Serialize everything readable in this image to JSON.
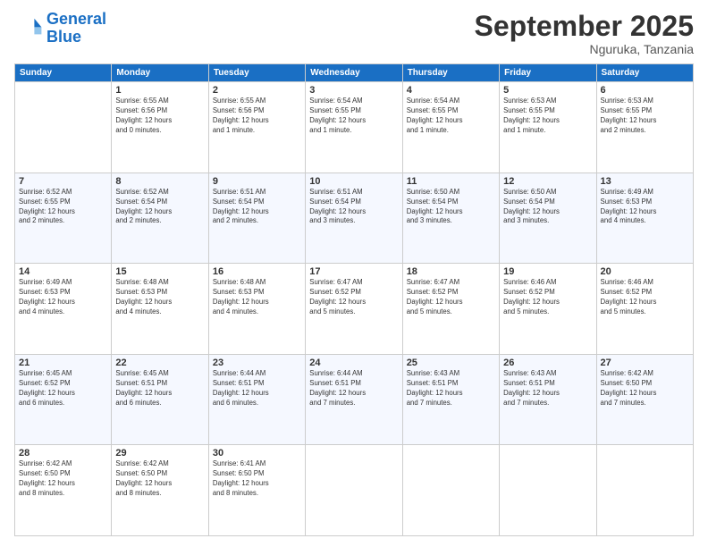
{
  "logo": {
    "line1": "General",
    "line2": "Blue"
  },
  "title": "September 2025",
  "location": "Nguruka, Tanzania",
  "days_header": [
    "Sunday",
    "Monday",
    "Tuesday",
    "Wednesday",
    "Thursday",
    "Friday",
    "Saturday"
  ],
  "weeks": [
    [
      {
        "day": "",
        "info": ""
      },
      {
        "day": "1",
        "info": "Sunrise: 6:55 AM\nSunset: 6:56 PM\nDaylight: 12 hours\nand 0 minutes."
      },
      {
        "day": "2",
        "info": "Sunrise: 6:55 AM\nSunset: 6:56 PM\nDaylight: 12 hours\nand 1 minute."
      },
      {
        "day": "3",
        "info": "Sunrise: 6:54 AM\nSunset: 6:55 PM\nDaylight: 12 hours\nand 1 minute."
      },
      {
        "day": "4",
        "info": "Sunrise: 6:54 AM\nSunset: 6:55 PM\nDaylight: 12 hours\nand 1 minute."
      },
      {
        "day": "5",
        "info": "Sunrise: 6:53 AM\nSunset: 6:55 PM\nDaylight: 12 hours\nand 1 minute."
      },
      {
        "day": "6",
        "info": "Sunrise: 6:53 AM\nSunset: 6:55 PM\nDaylight: 12 hours\nand 2 minutes."
      }
    ],
    [
      {
        "day": "7",
        "info": "Sunrise: 6:52 AM\nSunset: 6:55 PM\nDaylight: 12 hours\nand 2 minutes."
      },
      {
        "day": "8",
        "info": "Sunrise: 6:52 AM\nSunset: 6:54 PM\nDaylight: 12 hours\nand 2 minutes."
      },
      {
        "day": "9",
        "info": "Sunrise: 6:51 AM\nSunset: 6:54 PM\nDaylight: 12 hours\nand 2 minutes."
      },
      {
        "day": "10",
        "info": "Sunrise: 6:51 AM\nSunset: 6:54 PM\nDaylight: 12 hours\nand 3 minutes."
      },
      {
        "day": "11",
        "info": "Sunrise: 6:50 AM\nSunset: 6:54 PM\nDaylight: 12 hours\nand 3 minutes."
      },
      {
        "day": "12",
        "info": "Sunrise: 6:50 AM\nSunset: 6:54 PM\nDaylight: 12 hours\nand 3 minutes."
      },
      {
        "day": "13",
        "info": "Sunrise: 6:49 AM\nSunset: 6:53 PM\nDaylight: 12 hours\nand 4 minutes."
      }
    ],
    [
      {
        "day": "14",
        "info": "Sunrise: 6:49 AM\nSunset: 6:53 PM\nDaylight: 12 hours\nand 4 minutes."
      },
      {
        "day": "15",
        "info": "Sunrise: 6:48 AM\nSunset: 6:53 PM\nDaylight: 12 hours\nand 4 minutes."
      },
      {
        "day": "16",
        "info": "Sunrise: 6:48 AM\nSunset: 6:53 PM\nDaylight: 12 hours\nand 4 minutes."
      },
      {
        "day": "17",
        "info": "Sunrise: 6:47 AM\nSunset: 6:52 PM\nDaylight: 12 hours\nand 5 minutes."
      },
      {
        "day": "18",
        "info": "Sunrise: 6:47 AM\nSunset: 6:52 PM\nDaylight: 12 hours\nand 5 minutes."
      },
      {
        "day": "19",
        "info": "Sunrise: 6:46 AM\nSunset: 6:52 PM\nDaylight: 12 hours\nand 5 minutes."
      },
      {
        "day": "20",
        "info": "Sunrise: 6:46 AM\nSunset: 6:52 PM\nDaylight: 12 hours\nand 5 minutes."
      }
    ],
    [
      {
        "day": "21",
        "info": "Sunrise: 6:45 AM\nSunset: 6:52 PM\nDaylight: 12 hours\nand 6 minutes."
      },
      {
        "day": "22",
        "info": "Sunrise: 6:45 AM\nSunset: 6:51 PM\nDaylight: 12 hours\nand 6 minutes."
      },
      {
        "day": "23",
        "info": "Sunrise: 6:44 AM\nSunset: 6:51 PM\nDaylight: 12 hours\nand 6 minutes."
      },
      {
        "day": "24",
        "info": "Sunrise: 6:44 AM\nSunset: 6:51 PM\nDaylight: 12 hours\nand 7 minutes."
      },
      {
        "day": "25",
        "info": "Sunrise: 6:43 AM\nSunset: 6:51 PM\nDaylight: 12 hours\nand 7 minutes."
      },
      {
        "day": "26",
        "info": "Sunrise: 6:43 AM\nSunset: 6:51 PM\nDaylight: 12 hours\nand 7 minutes."
      },
      {
        "day": "27",
        "info": "Sunrise: 6:42 AM\nSunset: 6:50 PM\nDaylight: 12 hours\nand 7 minutes."
      }
    ],
    [
      {
        "day": "28",
        "info": "Sunrise: 6:42 AM\nSunset: 6:50 PM\nDaylight: 12 hours\nand 8 minutes."
      },
      {
        "day": "29",
        "info": "Sunrise: 6:42 AM\nSunset: 6:50 PM\nDaylight: 12 hours\nand 8 minutes."
      },
      {
        "day": "30",
        "info": "Sunrise: 6:41 AM\nSunset: 6:50 PM\nDaylight: 12 hours\nand 8 minutes."
      },
      {
        "day": "",
        "info": ""
      },
      {
        "day": "",
        "info": ""
      },
      {
        "day": "",
        "info": ""
      },
      {
        "day": "",
        "info": ""
      }
    ]
  ]
}
